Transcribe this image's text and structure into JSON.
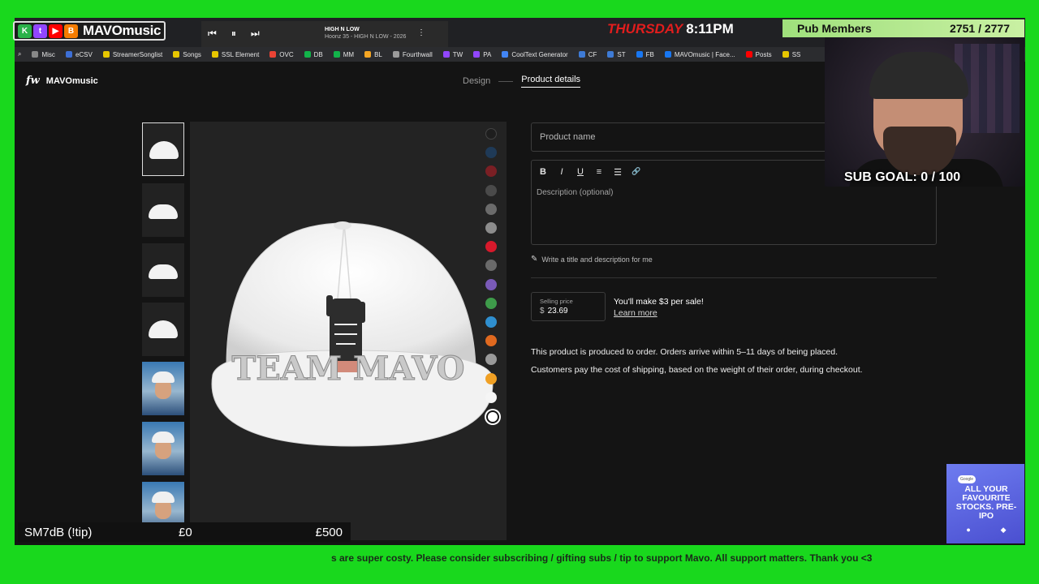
{
  "bookmarks": [
    {
      "label": "Misc",
      "color": "#888888"
    },
    {
      "label": "eCSV",
      "color": "#3d6fd6"
    },
    {
      "label": "StreamerSonglist",
      "color": "#e7c600"
    },
    {
      "label": "Songs",
      "color": "#e7c600"
    },
    {
      "label": "SSL Element",
      "color": "#e7c600"
    },
    {
      "label": "OVC",
      "color": "#ea4335"
    },
    {
      "label": "DB",
      "color": "#12b34a"
    },
    {
      "label": "MM",
      "color": "#12b34a"
    },
    {
      "label": "BL",
      "color": "#f5a623"
    },
    {
      "label": "Fourthwall",
      "color": "#9b9b9b"
    },
    {
      "label": "TW",
      "color": "#9146ff"
    },
    {
      "label": "PA",
      "color": "#9146ff"
    },
    {
      "label": "CoolText Generator",
      "color": "#4285f4"
    },
    {
      "label": "CF",
      "color": "#3e7bd6"
    },
    {
      "label": "ST",
      "color": "#3e7bd6"
    },
    {
      "label": "FB",
      "color": "#1877f2"
    },
    {
      "label": "MAVOmusic | Face...",
      "color": "#1877f2"
    },
    {
      "label": "Posts",
      "color": "#ff0000"
    },
    {
      "label": "SS",
      "color": "#e7c600"
    }
  ],
  "app": {
    "brand": "MAVOmusic",
    "logo_mark": "fw",
    "step1": "Design",
    "step2": "Product details"
  },
  "swatches": [
    "#1e1e1e",
    "#1f3a57",
    "#7a1f24",
    "#4a4a4a",
    "#6b6b6b",
    "#8c8c8c",
    "#d7192b",
    "#6a6a6a",
    "#7a5ab8",
    "#3e9b4a",
    "#2f8fcf",
    "#e0691f",
    "#9a9a9a",
    "#f0a024",
    "#f5f5f5",
    "#ffffff"
  ],
  "form": {
    "product_name_placeholder": "Product name",
    "toolbar": [
      "B",
      "I",
      "U",
      "≡",
      "☰",
      "🔗"
    ],
    "description_placeholder": "Description (optional)",
    "ai_write": "Write a title and description for me",
    "selling_price_label": "Selling price",
    "currency": "$",
    "price": "23.69",
    "earnings": "You'll make $3 per sale!",
    "learn_more": "Learn more",
    "info1": "This product is produced to order. Orders arrive within 5–11 days of being placed.",
    "info2": "Customers pay the cost of shipping, based on the weight of their order, during checkout."
  },
  "cap": {
    "text": "TEAM MAVO"
  },
  "overlay": {
    "brand_name": "MAVOmusic",
    "track_title": "HIGH N LOW",
    "track_artist": "Hoonz 35 - HIGH N LOW - 2026",
    "day": "THURSDAY",
    "time": "8:11PM",
    "pub_label": "Pub Members",
    "pub_count": "2751 / 2777",
    "sub_goal": "SUB GOAL: 0 / 100",
    "tip_label": "SM7dB (!tip)",
    "tip_min": "£0",
    "tip_max": "£500",
    "ad_text": "ALL YOUR FAVOURITE STOCKS. PRE-IPO",
    "ticker": "s are super costy. Please consider subscribing / gifting subs / tip to support Mavo. All support matters. Thank you <3"
  }
}
